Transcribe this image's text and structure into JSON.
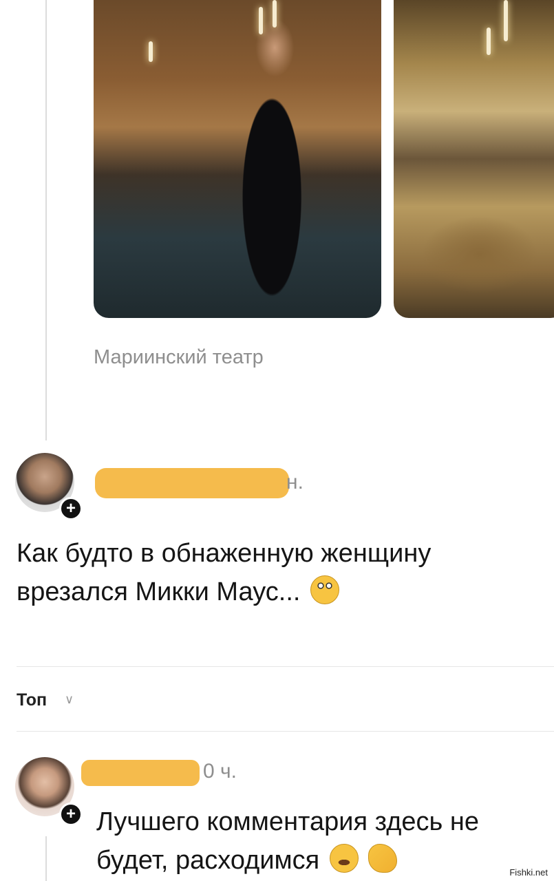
{
  "post": {
    "location": "Мариинский театр"
  },
  "comments": [
    {
      "time_suffix": "н.",
      "text": "Как будто в обнаженную женщину врезался Микки Маус...",
      "emoji": "face-with-rolling-eyes"
    },
    {
      "time_suffix": "0 ч.",
      "text": "Лучшего комментария здесь не будет, расходимся",
      "emoji": "rolling-on-floor-laughing + ok-hand"
    }
  ],
  "sort": {
    "label": "Топ"
  },
  "watermark": "Fishki.net",
  "colors": {
    "redaction": "#f5bb4c",
    "secondary_text": "#8e8e8e"
  }
}
